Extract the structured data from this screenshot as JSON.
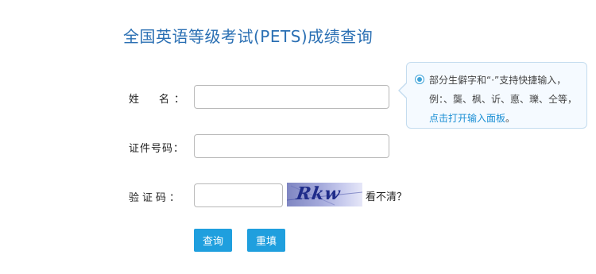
{
  "page": {
    "title": "全国英语等级考试(PETS)成绩查询"
  },
  "form": {
    "name_label": "姓　名：",
    "id_label": "证件号码：",
    "captcha_label": "验证码：",
    "name_value": "",
    "id_value": "",
    "captcha_value": "",
    "captcha_image_text": "Rkw",
    "refresh_text": "看不清？"
  },
  "tooltip": {
    "icon": "info-radio-icon",
    "text": "部分生僻字和“·”支持快捷输入，例：、龑、枫、䜣、悳、瓅、仝等，",
    "link": "点击打开输入面板",
    "suffix": "。"
  },
  "buttons": {
    "query": "查询",
    "reset": "重填"
  },
  "colors": {
    "title": "#2a6fb3",
    "button": "#1f9fde",
    "tooltip_border": "#c4dcef",
    "tooltip_background": "#f5faff",
    "link": "#1b8fd4"
  }
}
